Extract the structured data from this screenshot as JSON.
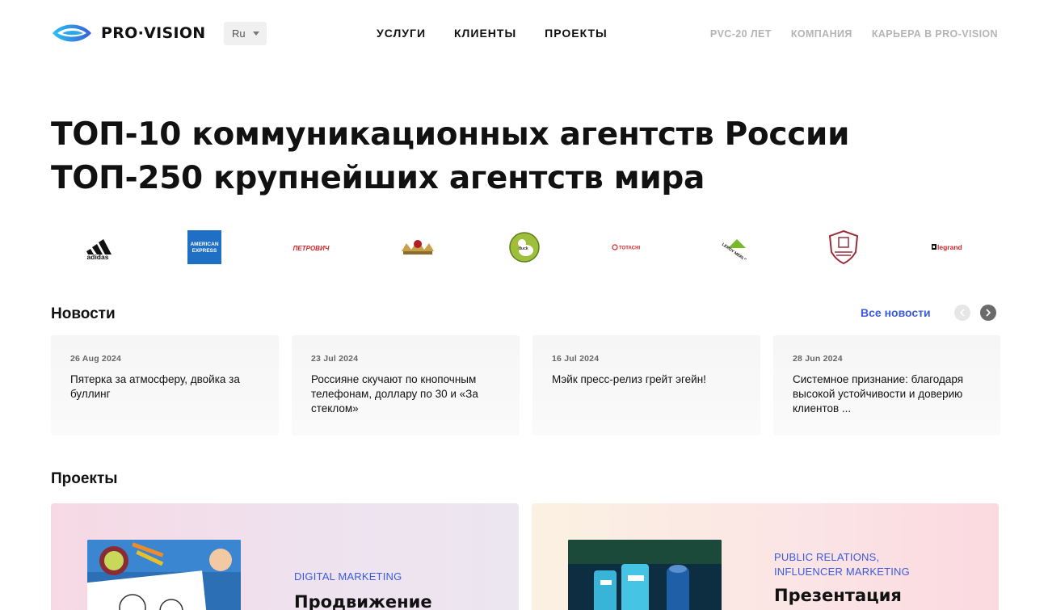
{
  "header": {
    "brand": "PRO·VISION",
    "lang": "Ru",
    "nav_main": [
      "УСЛУГИ",
      "КЛИЕНТЫ",
      "ПРОЕКТЫ"
    ],
    "nav_secondary": [
      "PVC-20 ЛЕТ",
      "КОМПАНИЯ",
      "КАРЬЕРА В PRO-VISION"
    ]
  },
  "hero": {
    "line1": "ТОП-10 коммуникационных агентств России",
    "line2": "ТОП-250 крупнейших агентств мира"
  },
  "clients": [
    {
      "name": "adidas",
      "label": "adidas"
    },
    {
      "name": "american-express",
      "label": "AMERICAN EXPRESS"
    },
    {
      "name": "petrovich",
      "label": "ПЕТРОВИЧ"
    },
    {
      "name": "crest",
      "label": ""
    },
    {
      "name": "duck",
      "label": "duck"
    },
    {
      "name": "totachi",
      "label": "TOTACHI"
    },
    {
      "name": "leroy-merlin",
      "label": "LEROY MERLIN"
    },
    {
      "name": "shield-crest",
      "label": ""
    },
    {
      "name": "legrand",
      "label": "legrand"
    }
  ],
  "news": {
    "title": "Новости",
    "all_link": "Все новости",
    "items": [
      {
        "date": "26 Aug 2024",
        "text": "Пятерка за атмосферу, двойка за буллинг"
      },
      {
        "date": "23 Jul 2024",
        "text": "Россияне скучают по кнопочным телефонам, доллару по 30 и «За стеклом»"
      },
      {
        "date": "16 Jul 2024",
        "text": "Мэйк пресс-релиз грейт эгейн!"
      },
      {
        "date": "28 Jun 2024",
        "text": "Системное признание: благодаря высокой устойчивости и доверию клиентов ..."
      }
    ]
  },
  "projects": {
    "title": "Проекты",
    "items": [
      {
        "tag": "DIGITAL MARKETING",
        "title": "Продвижение"
      },
      {
        "tag": "PUBLIC RELATIONS, INFLUENCER MARKETING",
        "title": "Презентация"
      }
    ]
  },
  "colors": {
    "accent": "#3b5bdb",
    "muted_nav": "#b4b4b4",
    "text": "#111111"
  }
}
